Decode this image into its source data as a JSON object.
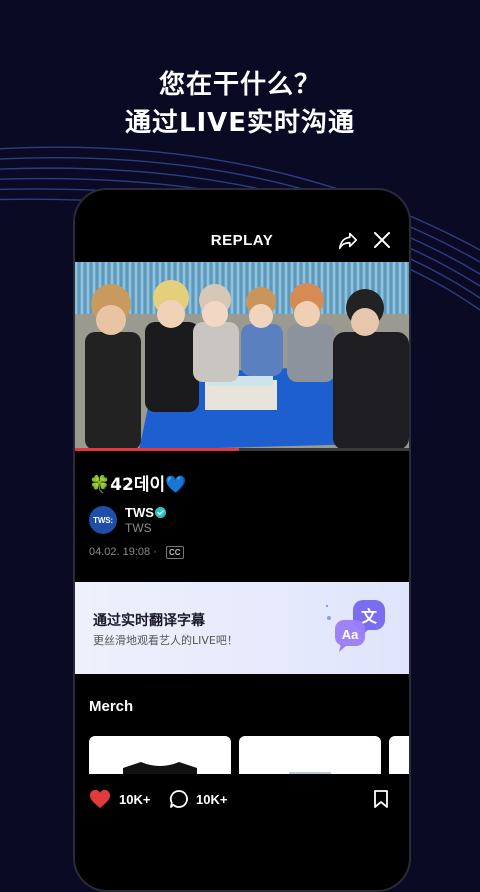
{
  "headline": {
    "line1": "您在干什么？",
    "line2": "通过LIVE实时沟通"
  },
  "player": {
    "title": "REPLAY",
    "share_icon": "share-icon",
    "close_icon": "close-icon",
    "progress_fraction": 0.49
  },
  "post": {
    "title": "🍀42데이💙",
    "artist_avatar_text": "TWS:",
    "artist_name": "TWS",
    "artist_handle": "TWS",
    "datetime": "04.02. 19:08 ·",
    "cc_badge": "CC"
  },
  "translate_banner": {
    "title": "通过实时翻译字幕",
    "subtitle": "更丝滑地观看艺人的LIVE吧！",
    "icon": "translate-icon"
  },
  "merch": {
    "title": "Merch"
  },
  "actions": {
    "likes": "10K+",
    "comments": "10K+"
  },
  "colors": {
    "background": "#0a0a24",
    "accent_red": "#e23a3a",
    "verified_teal": "#2bc4c4",
    "avatar_blue": "#1e4ea8"
  }
}
